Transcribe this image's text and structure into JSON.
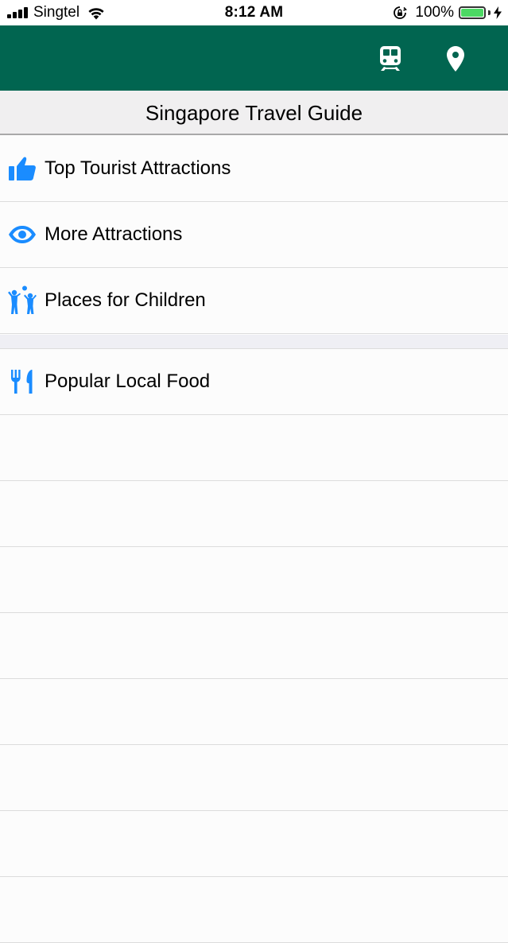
{
  "status_bar": {
    "carrier": "Singtel",
    "time": "8:12 AM",
    "battery_percent": "100%",
    "battery_level": 1.0,
    "icons": [
      "signal-bars-icon",
      "wifi-icon",
      "orientation-lock-icon",
      "battery-icon",
      "charging-bolt-icon"
    ]
  },
  "nav_bar": {
    "background_color": "#016550",
    "buttons": [
      {
        "icon": "train-icon"
      },
      {
        "icon": "map-pin-icon"
      }
    ]
  },
  "header": {
    "title": "Singapore Travel Guide"
  },
  "menu": {
    "accent_color": "#1a8cff",
    "section_1": [
      {
        "label": "Top Tourist Attractions",
        "icon": "thumbs-up-icon"
      },
      {
        "label": "More Attractions",
        "icon": "eye-icon"
      },
      {
        "label": "Places for Children",
        "icon": "children-icon"
      }
    ],
    "section_2": [
      {
        "label": "Popular Local Food",
        "icon": "fork-knife-icon"
      }
    ]
  }
}
